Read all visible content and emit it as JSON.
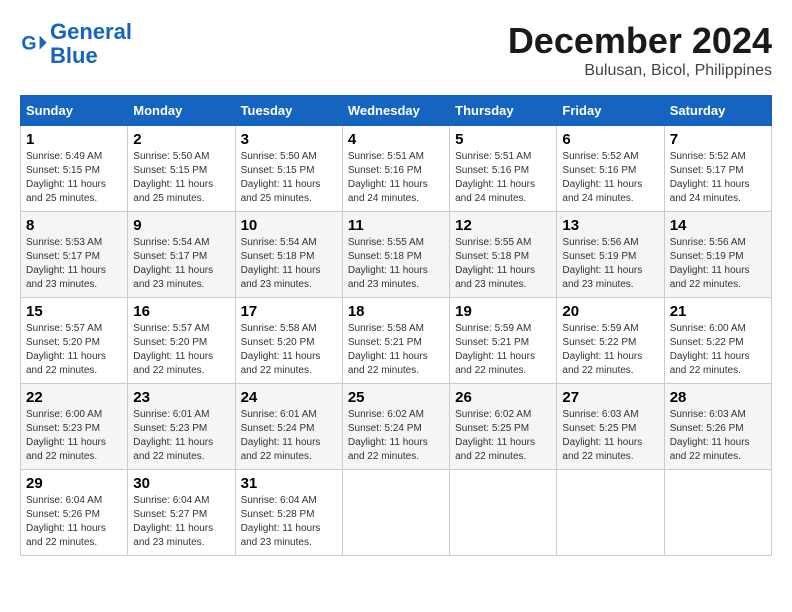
{
  "logo": {
    "line1": "General",
    "line2": "Blue"
  },
  "title": "December 2024",
  "subtitle": "Bulusan, Bicol, Philippines",
  "headers": [
    "Sunday",
    "Monday",
    "Tuesday",
    "Wednesday",
    "Thursday",
    "Friday",
    "Saturday"
  ],
  "weeks": [
    [
      {
        "day": "1",
        "info": "Sunrise: 5:49 AM\nSunset: 5:15 PM\nDaylight: 11 hours\nand 25 minutes."
      },
      {
        "day": "2",
        "info": "Sunrise: 5:50 AM\nSunset: 5:15 PM\nDaylight: 11 hours\nand 25 minutes."
      },
      {
        "day": "3",
        "info": "Sunrise: 5:50 AM\nSunset: 5:15 PM\nDaylight: 11 hours\nand 25 minutes."
      },
      {
        "day": "4",
        "info": "Sunrise: 5:51 AM\nSunset: 5:16 PM\nDaylight: 11 hours\nand 24 minutes."
      },
      {
        "day": "5",
        "info": "Sunrise: 5:51 AM\nSunset: 5:16 PM\nDaylight: 11 hours\nand 24 minutes."
      },
      {
        "day": "6",
        "info": "Sunrise: 5:52 AM\nSunset: 5:16 PM\nDaylight: 11 hours\nand 24 minutes."
      },
      {
        "day": "7",
        "info": "Sunrise: 5:52 AM\nSunset: 5:17 PM\nDaylight: 11 hours\nand 24 minutes."
      }
    ],
    [
      {
        "day": "8",
        "info": "Sunrise: 5:53 AM\nSunset: 5:17 PM\nDaylight: 11 hours\nand 23 minutes."
      },
      {
        "day": "9",
        "info": "Sunrise: 5:54 AM\nSunset: 5:17 PM\nDaylight: 11 hours\nand 23 minutes."
      },
      {
        "day": "10",
        "info": "Sunrise: 5:54 AM\nSunset: 5:18 PM\nDaylight: 11 hours\nand 23 minutes."
      },
      {
        "day": "11",
        "info": "Sunrise: 5:55 AM\nSunset: 5:18 PM\nDaylight: 11 hours\nand 23 minutes."
      },
      {
        "day": "12",
        "info": "Sunrise: 5:55 AM\nSunset: 5:18 PM\nDaylight: 11 hours\nand 23 minutes."
      },
      {
        "day": "13",
        "info": "Sunrise: 5:56 AM\nSunset: 5:19 PM\nDaylight: 11 hours\nand 23 minutes."
      },
      {
        "day": "14",
        "info": "Sunrise: 5:56 AM\nSunset: 5:19 PM\nDaylight: 11 hours\nand 22 minutes."
      }
    ],
    [
      {
        "day": "15",
        "info": "Sunrise: 5:57 AM\nSunset: 5:20 PM\nDaylight: 11 hours\nand 22 minutes."
      },
      {
        "day": "16",
        "info": "Sunrise: 5:57 AM\nSunset: 5:20 PM\nDaylight: 11 hours\nand 22 minutes."
      },
      {
        "day": "17",
        "info": "Sunrise: 5:58 AM\nSunset: 5:20 PM\nDaylight: 11 hours\nand 22 minutes."
      },
      {
        "day": "18",
        "info": "Sunrise: 5:58 AM\nSunset: 5:21 PM\nDaylight: 11 hours\nand 22 minutes."
      },
      {
        "day": "19",
        "info": "Sunrise: 5:59 AM\nSunset: 5:21 PM\nDaylight: 11 hours\nand 22 minutes."
      },
      {
        "day": "20",
        "info": "Sunrise: 5:59 AM\nSunset: 5:22 PM\nDaylight: 11 hours\nand 22 minutes."
      },
      {
        "day": "21",
        "info": "Sunrise: 6:00 AM\nSunset: 5:22 PM\nDaylight: 11 hours\nand 22 minutes."
      }
    ],
    [
      {
        "day": "22",
        "info": "Sunrise: 6:00 AM\nSunset: 5:23 PM\nDaylight: 11 hours\nand 22 minutes."
      },
      {
        "day": "23",
        "info": "Sunrise: 6:01 AM\nSunset: 5:23 PM\nDaylight: 11 hours\nand 22 minutes."
      },
      {
        "day": "24",
        "info": "Sunrise: 6:01 AM\nSunset: 5:24 PM\nDaylight: 11 hours\nand 22 minutes."
      },
      {
        "day": "25",
        "info": "Sunrise: 6:02 AM\nSunset: 5:24 PM\nDaylight: 11 hours\nand 22 minutes."
      },
      {
        "day": "26",
        "info": "Sunrise: 6:02 AM\nSunset: 5:25 PM\nDaylight: 11 hours\nand 22 minutes."
      },
      {
        "day": "27",
        "info": "Sunrise: 6:03 AM\nSunset: 5:25 PM\nDaylight: 11 hours\nand 22 minutes."
      },
      {
        "day": "28",
        "info": "Sunrise: 6:03 AM\nSunset: 5:26 PM\nDaylight: 11 hours\nand 22 minutes."
      }
    ],
    [
      {
        "day": "29",
        "info": "Sunrise: 6:04 AM\nSunset: 5:26 PM\nDaylight: 11 hours\nand 22 minutes."
      },
      {
        "day": "30",
        "info": "Sunrise: 6:04 AM\nSunset: 5:27 PM\nDaylight: 11 hours\nand 23 minutes."
      },
      {
        "day": "31",
        "info": "Sunrise: 6:04 AM\nSunset: 5:28 PM\nDaylight: 11 hours\nand 23 minutes."
      },
      null,
      null,
      null,
      null
    ]
  ]
}
